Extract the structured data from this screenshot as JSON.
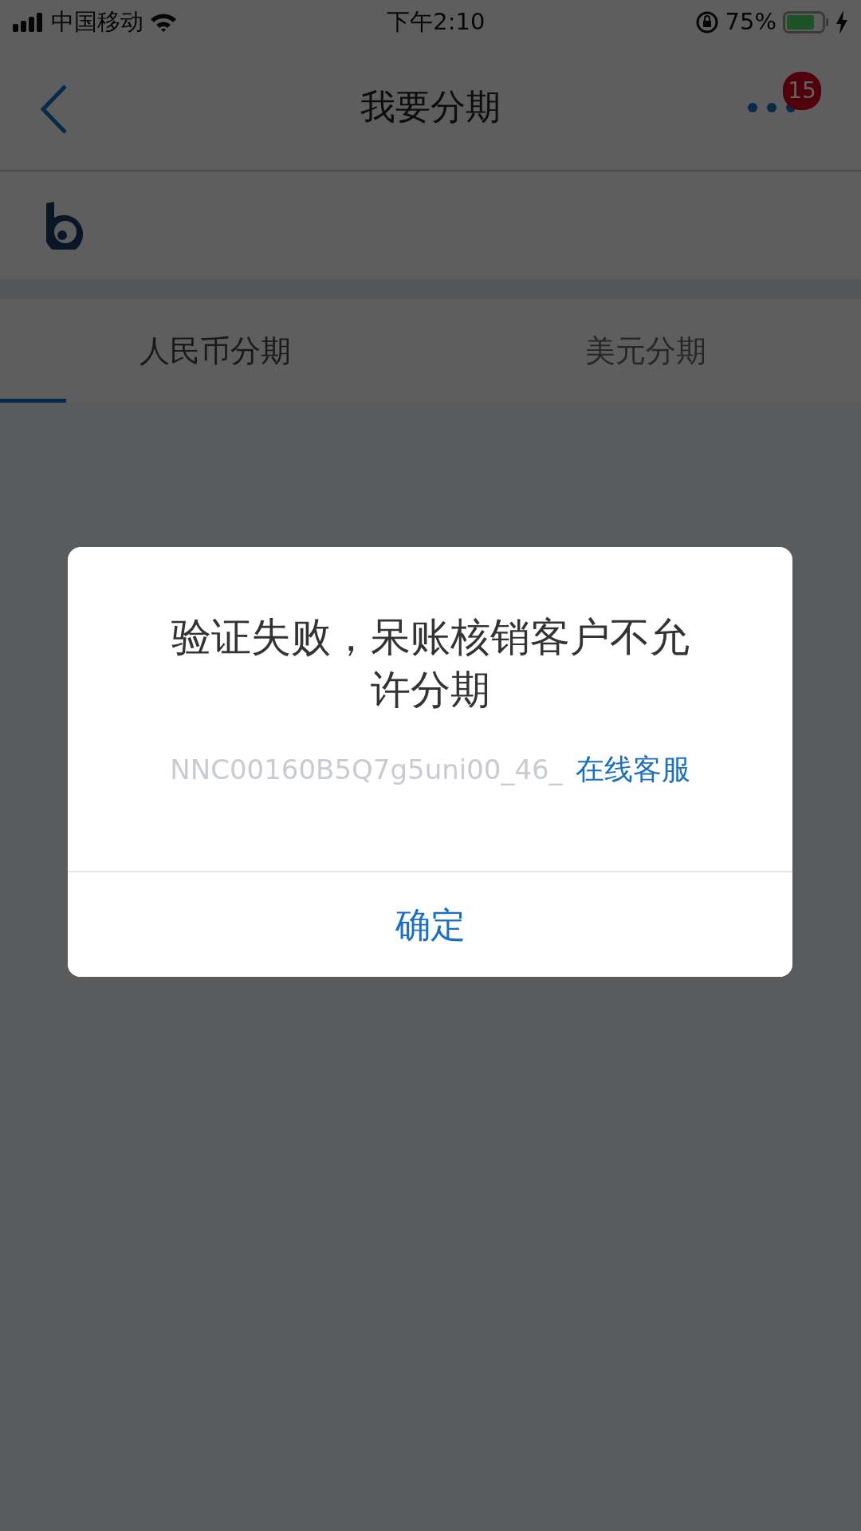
{
  "status_bar": {
    "carrier": "中国移动",
    "time": "下午2:10",
    "battery": "75%"
  },
  "nav": {
    "title": "我要分期",
    "badge": "15"
  },
  "tabs": [
    {
      "label": "人民币分期",
      "selected": true
    },
    {
      "label": "美元分期",
      "selected": false
    }
  ],
  "dialog": {
    "message": "验证失败，呆账核销客户不允许分期",
    "code": "NNC00160B5Q7g5uni00_46_",
    "link": "在线客服",
    "button": "确定"
  }
}
